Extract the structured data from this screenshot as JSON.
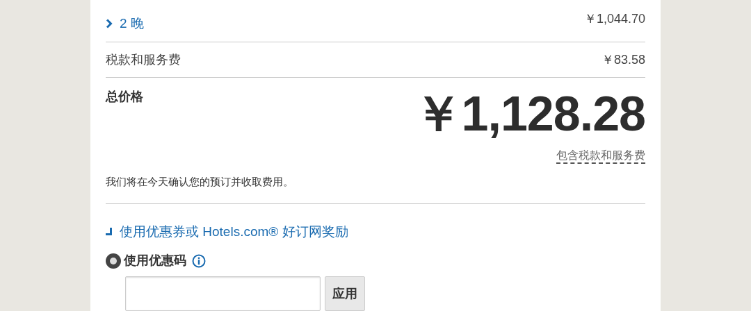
{
  "nights": {
    "label": "2 晚",
    "expanded": false,
    "amount": "￥1,044.70"
  },
  "taxes": {
    "label": "税款和服务费",
    "amount": "￥83.58"
  },
  "total": {
    "label": "总价格",
    "amount": "￥1,128.28",
    "note": "包含税款和服务费"
  },
  "notice": "我们将在今天确认您的预订并收取费用。",
  "coupon": {
    "toggle": {
      "label": "使用优惠券或 Hotels.com® 好订网奖励",
      "expanded": true
    },
    "option": {
      "label": "使用优惠码",
      "selected": true
    },
    "button": "应用"
  }
}
